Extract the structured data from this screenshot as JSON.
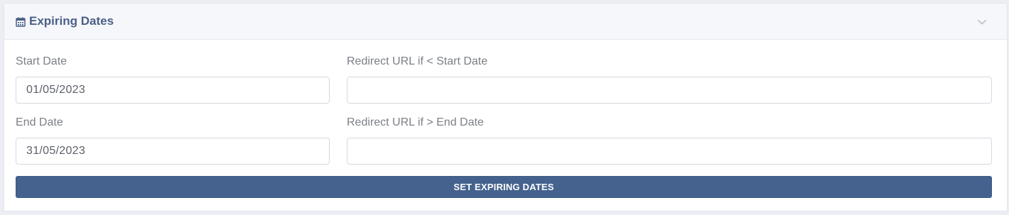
{
  "panel": {
    "title": "Expiring Dates",
    "title_icon": "calendar-icon",
    "collapse_icon": "chevron-down-icon"
  },
  "form": {
    "start_date": {
      "label": "Start Date",
      "value": "01/05/2023"
    },
    "redirect_before": {
      "label": "Redirect URL if < Start Date",
      "value": ""
    },
    "end_date": {
      "label": "End Date",
      "value": "31/05/2023"
    },
    "redirect_after": {
      "label": "Redirect URL if > End Date",
      "value": ""
    },
    "submit_label": "SET EXPIRING DATES"
  },
  "colors": {
    "accent": "#45628e",
    "title": "#4a5f87",
    "label": "#7c7f88"
  }
}
